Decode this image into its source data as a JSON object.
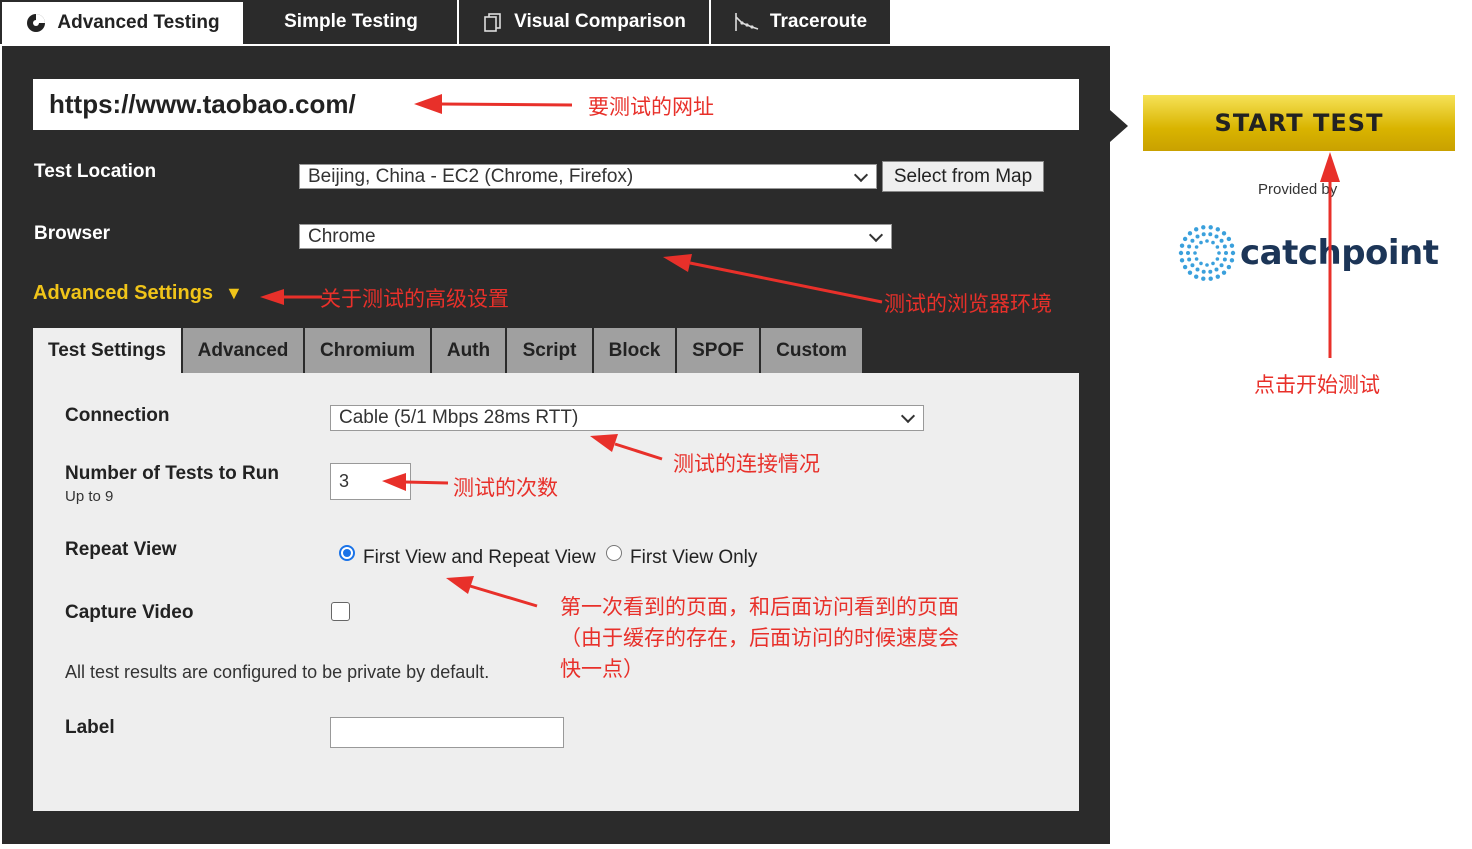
{
  "tabs": [
    {
      "label": "Advanced Testing",
      "icon": "chart-logo-icon",
      "active": true
    },
    {
      "label": "Simple Testing",
      "icon": "",
      "active": false
    },
    {
      "label": "Visual Comparison",
      "icon": "document-copy-icon",
      "active": false
    },
    {
      "label": "Traceroute",
      "icon": "traceroute-icon",
      "active": false
    }
  ],
  "url": {
    "value": "https://www.taobao.com/"
  },
  "test_location": {
    "label": "Test Location",
    "value": "Beijing, China - EC2 (Chrome, Firefox)",
    "map_button": "Select from Map"
  },
  "browser": {
    "label": "Browser",
    "value": "Chrome"
  },
  "advanced_settings": {
    "label": "Advanced Settings",
    "toggle": "▼"
  },
  "settings_tabs": [
    "Test Settings",
    "Advanced",
    "Chromium",
    "Auth",
    "Script",
    "Block",
    "SPOF",
    "Custom"
  ],
  "settings": {
    "connection": {
      "label": "Connection",
      "value": "Cable (5/1 Mbps 28ms RTT)"
    },
    "num_tests": {
      "label": "Number of Tests to Run",
      "hint": "Up to 9",
      "value": "3"
    },
    "repeat_view": {
      "label": "Repeat View",
      "option_1": "First View and Repeat View",
      "option_2": "First View Only",
      "selected": "option_1"
    },
    "capture_video": {
      "label": "Capture Video",
      "checked": false
    },
    "private_note": "All test results are configured to be private by default.",
    "label_field": {
      "label": "Label",
      "value": ""
    }
  },
  "start_test": {
    "label": "START TEST"
  },
  "sponsor": {
    "provided_by": "Provided by",
    "logo_text": "catchpoint"
  },
  "annotations": {
    "url": "要测试的网址",
    "advanced": "关于测试的高级设置",
    "browser": "测试的浏览器环境",
    "start": "点击开始测试",
    "connection": "测试的连接情况",
    "num_tests": "测试的次数",
    "repeat_view": "第一次看到的页面，和后面访问看到的页面（由于缓存的存在，后面访问的时候速度会快一点）"
  },
  "colors": {
    "panel": "#2b2b2b",
    "accent_yellow": "#f0c419",
    "annotation_red": "#e8302a",
    "settings_bg": "#eeeeee",
    "inactive_tab": "#a0a0a0"
  }
}
